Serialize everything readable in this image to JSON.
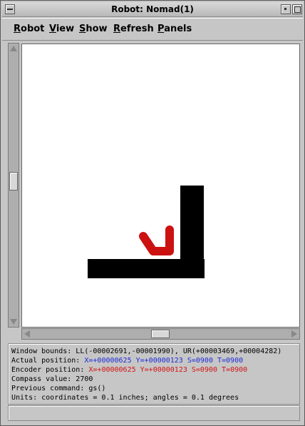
{
  "window": {
    "title": "Robot: Nomad(1)"
  },
  "menu": [
    "Robot",
    "View",
    "Show",
    "Refresh",
    "Panels"
  ],
  "info": {
    "bounds": "Window bounds: LL(-00002691,-00001990), UR(+00003469,+00004282)",
    "actual_label": "Actual  position:",
    "actual_values": "X=+00000625 Y=+00000123 S=0900 T=0900",
    "encoder_label": "Encoder position:",
    "encoder_values": "X=+00000625 Y=+00000123 S=0900 T=0900",
    "compass": "Compass value: 2700",
    "previous_command": "Previous command: gs()",
    "units": "Units: coordinates = 0.1 inches; angles = 0.1 degrees"
  },
  "colors": {
    "actual": "#1f2bd6",
    "encoder": "#d41414",
    "robot": "#cc1111",
    "obstacle": "#000000"
  },
  "icons": [
    "window-menu-icon",
    "minimize-icon",
    "maximize-icon",
    "arrow-up-icon",
    "arrow-down-icon",
    "arrow-left-icon",
    "arrow-right-icon"
  ]
}
